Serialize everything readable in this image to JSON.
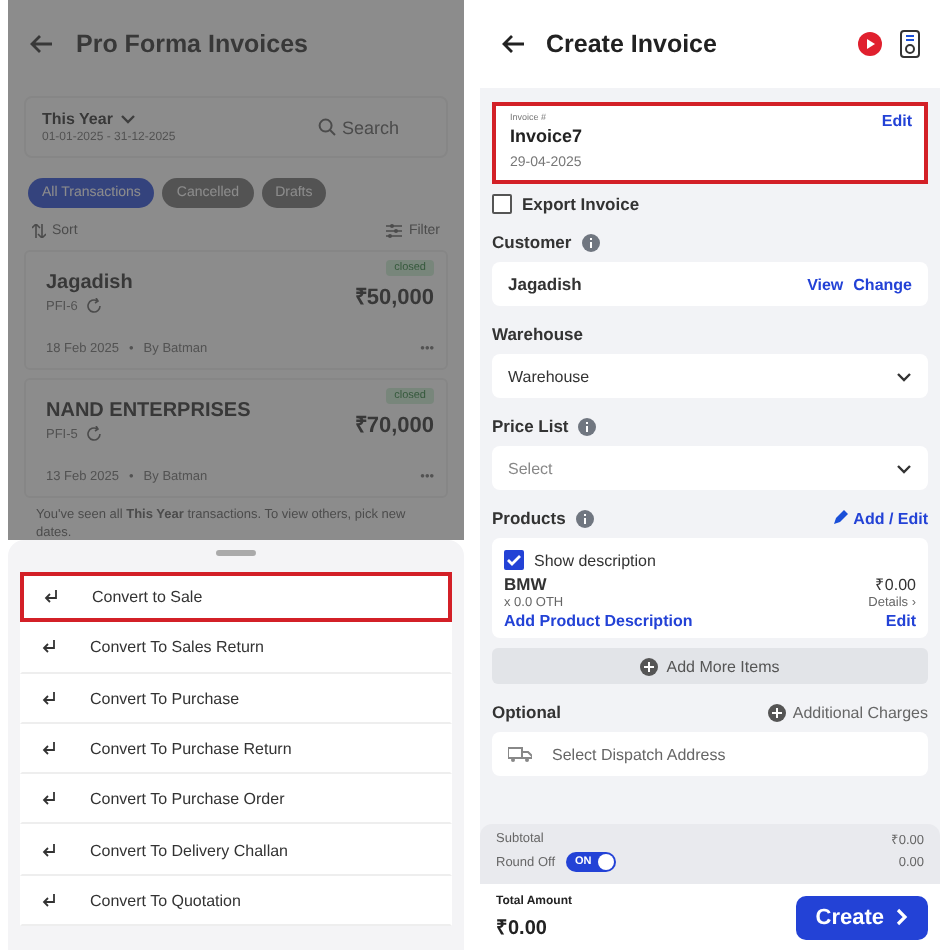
{
  "list_screen": {
    "title": "Pro Forma Invoices",
    "period": {
      "label": "This Year",
      "range": "01-01-2025 - 31-12-2025"
    },
    "search": {
      "placeholder": "Search"
    },
    "filters": [
      {
        "label": "All Transactions",
        "selected": true
      },
      {
        "label": "Cancelled",
        "selected": false
      },
      {
        "label": "Drafts",
        "selected": false
      }
    ],
    "sort": "Sort",
    "filter": "Filter",
    "transactions": [
      {
        "name": "Jagadish",
        "code": "PFI-6",
        "amount": "₹50,000",
        "status": "closed",
        "date": "18 Feb 2025",
        "separator": "•",
        "by": "By Batman",
        "more": "•••"
      },
      {
        "name": "NAND ENTERPRISES",
        "code": "PFI-5",
        "amount": "₹70,000",
        "status": "closed",
        "date": "13 Feb 2025",
        "separator": "•",
        "by": "By Batman",
        "more": "•••"
      }
    ],
    "note": "You've seen all **This Year** transactions. To view others, pick new dates.",
    "sheet": {
      "actions": [
        {
          "label": "Convert to Sale",
          "selected": true
        },
        {
          "label": "Convert To Sales Return",
          "selected": false
        },
        {
          "label": "Convert To Purchase",
          "selected": false
        },
        {
          "label": "Convert To Purchase Return",
          "selected": false
        },
        {
          "label": "Convert To Purchase Order",
          "selected": false
        },
        {
          "label": "Convert To Delivery Challan",
          "selected": false
        },
        {
          "label": "Convert To Quotation",
          "selected": false
        }
      ]
    }
  },
  "invoice_screen": {
    "title": "Create Invoice",
    "invoice": {
      "label": "Invoice #",
      "number": "Invoice7",
      "date": "29-04-2025",
      "edit": "Edit",
      "highlighted": true
    },
    "export": {
      "label": "Export Invoice",
      "checked": false
    },
    "customer": {
      "label": "Customer",
      "name": "Jagadish",
      "view": "View",
      "change": "Change"
    },
    "warehouse": {
      "label": "Warehouse",
      "value": "Warehouse"
    },
    "price_list": {
      "label": "Price List",
      "placeholder": "Select"
    },
    "products": {
      "label": "Products",
      "add_edit": "Add / Edit",
      "show_description": {
        "label": "Show description",
        "checked": true
      },
      "items": [
        {
          "name": "BMW",
          "quantity": "x 0.0 OTH",
          "price": "₹0.00",
          "details": "Details ›",
          "add_description": "Add Product Description",
          "edit": "Edit"
        }
      ],
      "add_more": "Add More Items"
    },
    "optional": {
      "label": "Optional",
      "additional_charges": "Additional Charges",
      "dispatch": "Select Dispatch Address"
    },
    "summary": {
      "subtotal_label": "Subtotal",
      "subtotal": "₹0.00",
      "round_off_label": "Round Off",
      "round_off": {
        "on": true,
        "text": "ON"
      },
      "round_off_value": "0.00"
    },
    "total": {
      "label": "Total Amount",
      "value": "₹0.00"
    },
    "create": "Create"
  }
}
